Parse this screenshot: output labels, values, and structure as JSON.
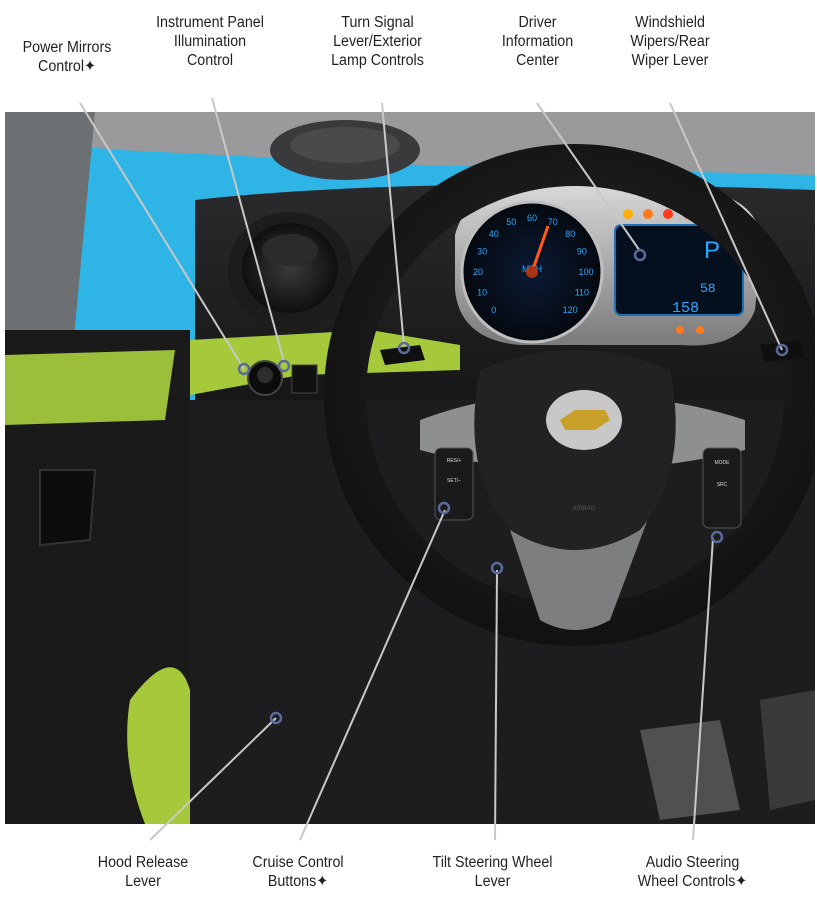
{
  "diagram": {
    "callouts": [
      {
        "id": "power-mirrors",
        "lines": [
          "Power Mirrors",
          "Control✦"
        ]
      },
      {
        "id": "instrument-panel-illumination",
        "lines": [
          "Instrument Panel",
          "Illumination",
          "Control"
        ]
      },
      {
        "id": "turn-signal",
        "lines": [
          "Turn Signal",
          "Lever/Exterior",
          "Lamp Controls"
        ]
      },
      {
        "id": "driver-information-center",
        "lines": [
          "Driver",
          "Information",
          "Center"
        ]
      },
      {
        "id": "windshield-wipers",
        "lines": [
          "Windshield",
          "Wipers/Rear",
          "Wiper Lever"
        ]
      },
      {
        "id": "hood-release",
        "lines": [
          "Hood Release",
          "Lever"
        ]
      },
      {
        "id": "cruise-control",
        "lines": [
          "Cruise Control",
          "Buttons✦"
        ]
      },
      {
        "id": "tilt-steering",
        "lines": [
          "Tilt Steering Wheel",
          "Lever"
        ]
      },
      {
        "id": "audio-steering",
        "lines": [
          "Audio Steering",
          "Wheel Controls✦"
        ]
      }
    ],
    "gauges": {
      "speedometer_unit": "MPH",
      "speed_ticks": [
        "0",
        "10",
        "20",
        "30",
        "40",
        "50",
        "60",
        "70",
        "80",
        "90",
        "100",
        "110",
        "120"
      ],
      "odometer": "58",
      "trip": "158",
      "gear": "P"
    },
    "steering_wheel": {
      "left_buttons": [
        "RES/+",
        "SET/–"
      ],
      "right_buttons": [
        "MODE",
        "SRC"
      ],
      "airbag_text": "AIRBAG"
    },
    "colors": {
      "sky": "#2fb4e6",
      "accent_green": "#a6c93b",
      "callout_line": "#c8c8c8",
      "marker_ring": "#5a6a9a",
      "gauge_blue": "#29a8ff",
      "gauge_orange": "#ff7a1a"
    }
  }
}
